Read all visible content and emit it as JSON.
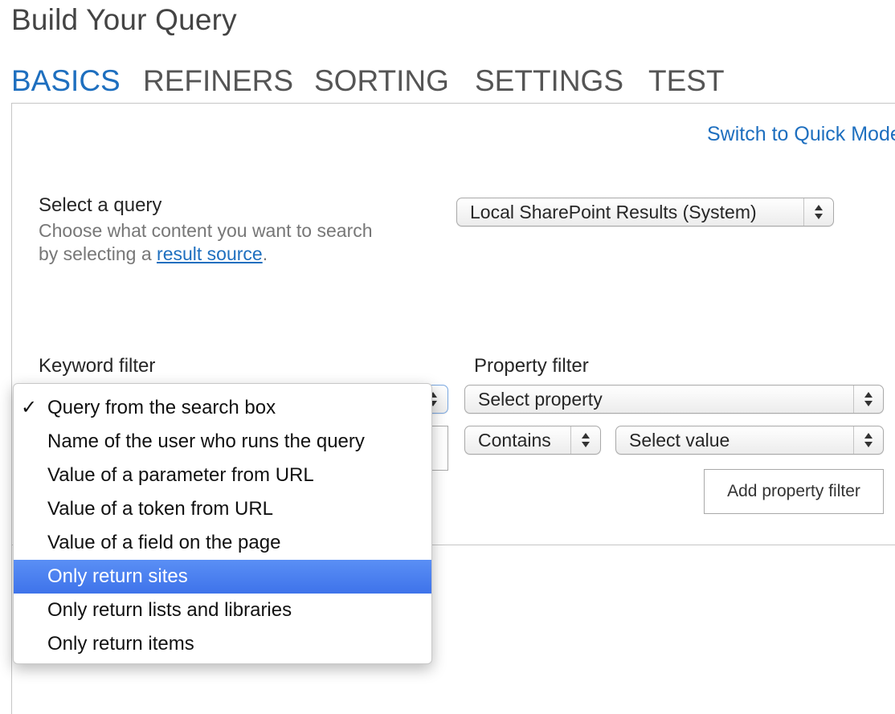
{
  "page_title": "Build Your Query",
  "tabs": [
    {
      "label": "BASICS",
      "active": true
    },
    {
      "label": "REFINERS",
      "active": false
    },
    {
      "label": "SORTING",
      "active": false
    },
    {
      "label": "SETTINGS",
      "active": false
    },
    {
      "label": "TEST",
      "active": false
    }
  ],
  "switch_mode_link": "Switch to Quick Mode",
  "select_query": {
    "label": "Select a query",
    "description_line1": "Choose what content you want to search",
    "description_prefix": "by selecting a ",
    "description_link": "result source",
    "description_suffix": ".",
    "selected_value": "Local SharePoint Results (System)"
  },
  "keyword_filter": {
    "label": "Keyword filter",
    "options": [
      {
        "label": "Query from the search box",
        "checked": true,
        "highlighted": false
      },
      {
        "label": "Name of the user who runs the query",
        "checked": false,
        "highlighted": false
      },
      {
        "label": "Value of a parameter from URL",
        "checked": false,
        "highlighted": false
      },
      {
        "label": "Value of a token from URL",
        "checked": false,
        "highlighted": false
      },
      {
        "label": "Value of a field on the page",
        "checked": false,
        "highlighted": false
      },
      {
        "label": "Only return sites",
        "checked": false,
        "highlighted": true
      },
      {
        "label": "Only return lists and libraries",
        "checked": false,
        "highlighted": false
      },
      {
        "label": "Only return items",
        "checked": false,
        "highlighted": false
      }
    ],
    "check_glyph": "✓"
  },
  "property_filter": {
    "label": "Property filter",
    "property_select": "Select property",
    "operator_select": "Contains",
    "value_select": "Select value",
    "add_button": "Add property filter"
  },
  "colors": {
    "accent_blue": "#1e6fbf",
    "highlight_blue": "#4a7ff0",
    "tab_gray": "#555555"
  },
  "icons": {
    "select_arrows": "up-down-arrows-icon",
    "check": "checkmark-icon"
  }
}
